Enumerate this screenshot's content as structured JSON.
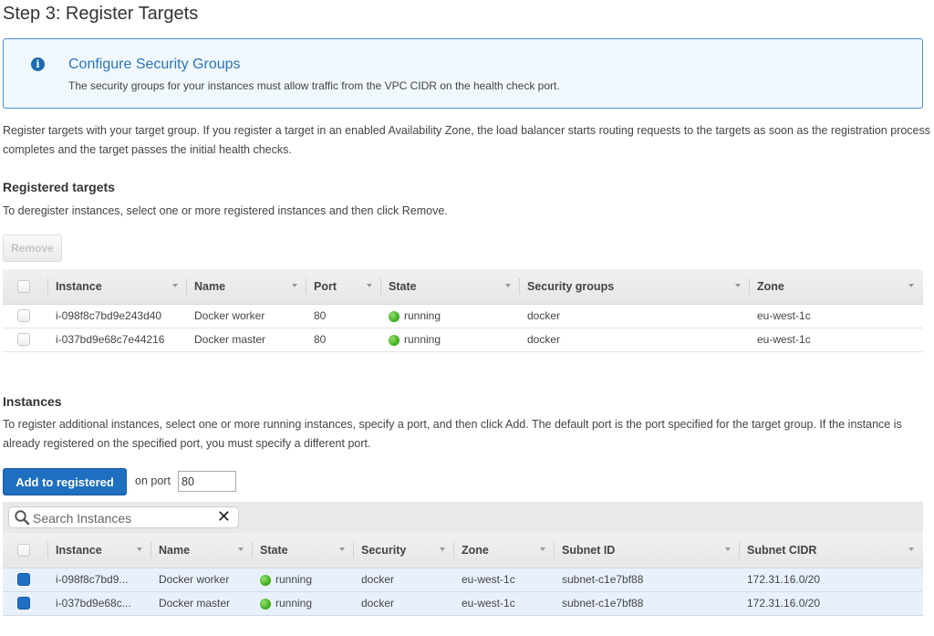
{
  "page": {
    "title": "Step 3: Register Targets"
  },
  "info": {
    "icon": "info-icon",
    "glyph": "i",
    "title": "Configure Security Groups",
    "text": "The security groups for your instances must allow traffic from the VPC CIDR on the health check port."
  },
  "intro": "Register targets with your target group. If you register a target in an enabled Availability Zone, the load balancer starts routing requests to the targets as soon as the registration process completes and the target passes the initial health checks.",
  "registered": {
    "heading": "Registered targets",
    "description": "To deregister instances, select one or more registered instances and then click Remove.",
    "remove_label": "Remove",
    "columns": [
      "Instance",
      "Name",
      "Port",
      "State",
      "Security groups",
      "Zone"
    ],
    "rows": [
      {
        "instance": "i-098f8c7bd9e243d40",
        "name": "Docker worker",
        "port": "80",
        "state": "running",
        "security_groups": "docker",
        "zone": "eu-west-1c",
        "checked": false
      },
      {
        "instance": "i-037bd9e68c7e44216",
        "name": "Docker master",
        "port": "80",
        "state": "running",
        "security_groups": "docker",
        "zone": "eu-west-1c",
        "checked": false
      }
    ]
  },
  "instances": {
    "heading": "Instances",
    "description": "To register additional instances, select one or more running instances, specify a port, and then click Add. The default port is the port specified for the target group. If the instance is already registered on the specified port, you must specify a different port.",
    "add_label": "Add to registered",
    "port_label": "on port",
    "port_value": "80",
    "search": {
      "placeholder": "Search Instances",
      "value": "",
      "clear_glyph": "✕"
    },
    "columns": [
      "Instance",
      "Name",
      "State",
      "Security",
      "Zone",
      "Subnet ID",
      "Subnet CIDR"
    ],
    "rows": [
      {
        "instance": "i-098f8c7bd9...",
        "name": "Docker worker",
        "state": "running",
        "security": "docker",
        "zone": "eu-west-1c",
        "subnet_id": "subnet-c1e7bf88",
        "subnet_cidr": "172.31.16.0/20",
        "checked": true
      },
      {
        "instance": "i-037bd9e68c...",
        "name": "Docker master",
        "state": "running",
        "security": "docker",
        "zone": "eu-west-1c",
        "subnet_id": "subnet-c1e7bf88",
        "subnet_cidr": "172.31.16.0/20",
        "checked": true
      }
    ]
  },
  "colors": {
    "primary_button": "#1e6fc0",
    "info_border": "#4d8ec6",
    "info_bg": "#f0f8fe",
    "running": "#3aa71c",
    "selected_row": "#e8f1fb"
  }
}
